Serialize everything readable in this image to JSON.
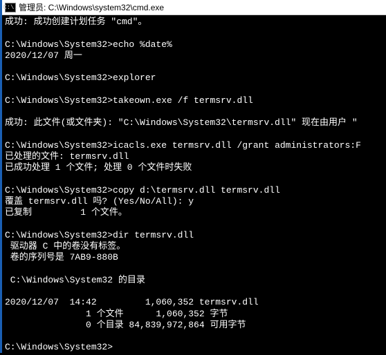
{
  "titlebar": {
    "icon_label": "C:\\.",
    "text": "管理员: C:\\Windows\\system32\\cmd.exe"
  },
  "lines": [
    "成功: 成功创建计划任务 \"cmd\"。",
    "",
    "C:\\Windows\\System32>echo %date%",
    "2020/12/07 周一",
    "",
    "C:\\Windows\\System32>explorer",
    "",
    "C:\\Windows\\System32>takeown.exe /f termsrv.dll",
    "",
    "成功: 此文件(或文件夹): \"C:\\Windows\\System32\\termsrv.dll\" 现在由用户 \"",
    "",
    "C:\\Windows\\System32>icacls.exe termsrv.dll /grant administrators:F",
    "已处理的文件: termsrv.dll",
    "已成功处理 1 个文件; 处理 0 个文件时失败",
    "",
    "C:\\Windows\\System32>copy d:\\termsrv.dll termsrv.dll",
    "覆盖 termsrv.dll 吗? (Yes/No/All): y",
    "已复制         1 个文件。",
    "",
    "C:\\Windows\\System32>dir termsrv.dll",
    " 驱动器 C 中的卷没有标签。",
    " 卷的序列号是 7AB9-880B",
    "",
    " C:\\Windows\\System32 的目录",
    "",
    "2020/12/07  14:42         1,060,352 termsrv.dll",
    "               1 个文件      1,060,352 字节",
    "               0 个目录 84,839,972,864 可用字节",
    "",
    "C:\\Windows\\System32>"
  ]
}
